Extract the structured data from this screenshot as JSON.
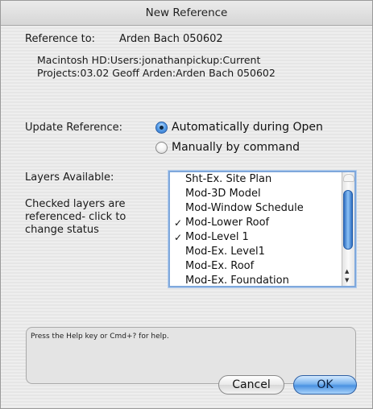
{
  "window": {
    "title": "New Reference"
  },
  "reference": {
    "label": "Reference to:",
    "name": "Arden Bach 050602",
    "path_line1": "Macintosh HD:Users:jonathanpickup:Current",
    "path_line2": "Projects:03.02 Geoff Arden:Arden Bach 050602"
  },
  "update": {
    "label": "Update Reference:",
    "options": [
      {
        "label": "Automatically during Open",
        "selected": true
      },
      {
        "label": "Manually by command",
        "selected": false
      }
    ]
  },
  "layers": {
    "label": "Layers Available:",
    "hint_line1": "Checked layers are",
    "hint_line2": "referenced- click to",
    "hint_line3": "change status",
    "check_mark": "✓",
    "items": [
      {
        "label": "Sht-Ex. Site Plan",
        "checked": false
      },
      {
        "label": "Mod-3D Model",
        "checked": false
      },
      {
        "label": "Mod-Window Schedule",
        "checked": false
      },
      {
        "label": "Mod-Lower Roof",
        "checked": true
      },
      {
        "label": "Mod-Level 1",
        "checked": true
      },
      {
        "label": "Mod-Ex. Level1",
        "checked": false
      },
      {
        "label": "Mod-Ex. Roof",
        "checked": false
      },
      {
        "label": "Mod-Ex. Foundation",
        "checked": false
      }
    ]
  },
  "help": {
    "text": "Press the Help key or Cmd+? for help."
  },
  "buttons": {
    "cancel": "Cancel",
    "ok": "OK"
  },
  "colors": {
    "accent": "#4a92e2",
    "window_bg": "#ececec"
  }
}
